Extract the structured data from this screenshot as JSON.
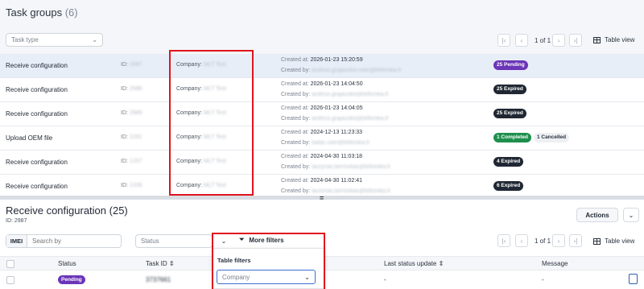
{
  "top": {
    "title": "Task groups",
    "count": "(6)",
    "task_type_placeholder": "Task type",
    "pager": "1 of 1",
    "table_view": "Table view"
  },
  "rows": [
    {
      "name": "Receive configuration",
      "id_label": "ID:",
      "id_value": "2987",
      "company_label": "Company:",
      "company_value": "MLT Test",
      "created_at_label": "Created at:",
      "created_at": "2026-01-23 15:20:59",
      "created_by_label": "Created by:",
      "created_by": "andrius.grajauskis-user@teltonika.lt",
      "badges": [
        {
          "text": "25 Pending",
          "kind": "pending"
        }
      ]
    },
    {
      "name": "Receive configuration",
      "id_label": "ID:",
      "id_value": "2986",
      "company_label": "Company:",
      "company_value": "MLT Test",
      "created_at_label": "Created at:",
      "created_at": "2026-01-23 14:04:50",
      "created_by_label": "Created by:",
      "created_by": "andrius.grajauskis@teltonika.lt",
      "badges": [
        {
          "text": "25 Expired",
          "kind": "expired"
        }
      ]
    },
    {
      "name": "Receive configuration",
      "id_label": "ID:",
      "id_value": "2985",
      "company_label": "Company:",
      "company_value": "MLT Test",
      "created_at_label": "Created at:",
      "created_at": "2026-01-23 14:04:05",
      "created_by_label": "Created by:",
      "created_by": "andrius.grajauskis@teltonika.lt",
      "badges": [
        {
          "text": "25 Expired",
          "kind": "expired"
        }
      ]
    },
    {
      "name": "Upload OEM file",
      "id_label": "ID:",
      "id_value": "2281",
      "company_label": "Company:",
      "company_value": "MLT Test",
      "created_at_label": "Created at:",
      "created_at": "2024-12-13 11:23:33",
      "created_by_label": "Created by:",
      "created_by": "tadas.user@teltonika.lt",
      "badges": [
        {
          "text": "1 Completed",
          "kind": "completed"
        },
        {
          "text": "1 Cancelled",
          "kind": "cancelled"
        }
      ]
    },
    {
      "name": "Receive configuration",
      "id_label": "ID:",
      "id_value": "1207",
      "company_label": "Company:",
      "company_value": "MLT Test",
      "created_at_label": "Created at:",
      "created_at": "2024-04-30 11:03:18",
      "created_by_label": "Created by:",
      "created_by": "laurynas.berniukas@teltonika.lt",
      "badges": [
        {
          "text": "4 Expired",
          "kind": "expired"
        }
      ]
    },
    {
      "name": "Receive configuration",
      "id_label": "ID:",
      "id_value": "1206",
      "company_label": "Company:",
      "company_value": "MLT Test",
      "created_at_label": "Created at:",
      "created_at": "2024-04-30 11:02:41",
      "created_by_label": "Created by:",
      "created_by": "laurynas.berniukas@teltonika.lt",
      "badges": [
        {
          "text": "6 Expired",
          "kind": "expired"
        }
      ]
    }
  ],
  "handle": "=",
  "detail": {
    "title": "Receive configuration (25)",
    "id_line": "ID: 2987",
    "actions": "Actions",
    "imei_label": "IMEI",
    "search_placeholder": "Search by",
    "status_placeholder": "Status",
    "more_filters": "More filters",
    "pager": "1 of 1",
    "table_view": "Table view",
    "columns": [
      "Status",
      "Task ID",
      "Last status update",
      "Message"
    ],
    "first_row": {
      "status": "Pending",
      "task_id": "3737661",
      "last_update": "-",
      "message": "-"
    }
  },
  "dropdown": {
    "title": "Table filters",
    "selected": "Company"
  },
  "colors": {
    "pending": "#6b35b8",
    "expired": "#1f2733",
    "completed": "#1e8f4e",
    "highlight": "#e0141e",
    "selected_row": "#e8eef8"
  }
}
